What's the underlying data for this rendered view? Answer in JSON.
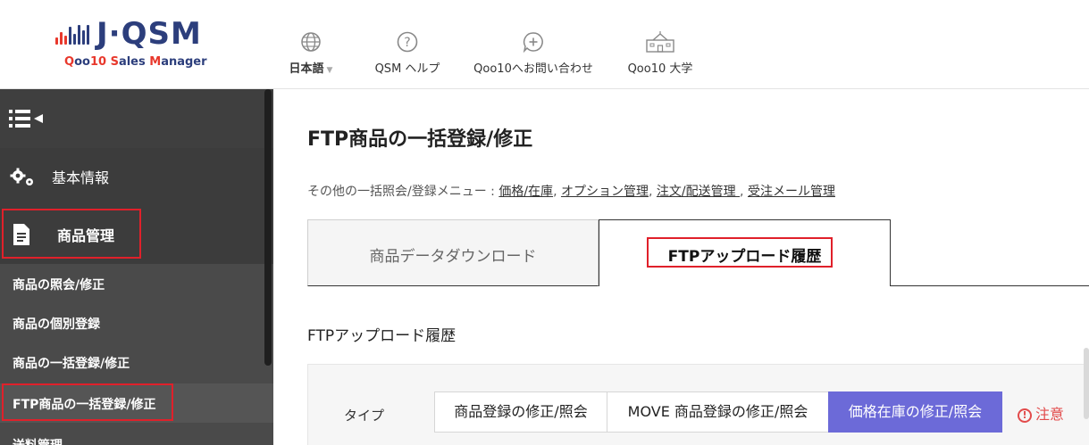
{
  "logo": {
    "brand": "J·QSM",
    "sub_q": "Q",
    "sub_oo": "oo",
    "sub_10": "10",
    "sub_s": "S",
    "sub_ales": "ales ",
    "sub_m": "M",
    "sub_anager": "anager",
    "bar_colors": [
      "#e8382c",
      "#2c3e7c"
    ]
  },
  "topnav": {
    "items": [
      {
        "label": "日本語",
        "icon": "globe-icon"
      },
      {
        "label": "QSM ヘルプ",
        "icon": "help-circle-icon"
      },
      {
        "label": "Qoo10へお問い合わせ",
        "icon": "chat-plus-icon"
      },
      {
        "label": "Qoo10 大学",
        "icon": "school-icon"
      }
    ]
  },
  "sidebar": {
    "basic": "基本情報",
    "goods": "商品管理",
    "subitems": [
      {
        "label": "商品の照会/修正"
      },
      {
        "label": "商品の個別登録"
      },
      {
        "label": "商品の一括登録/修正"
      },
      {
        "label": "FTP商品の一括登録/修正"
      },
      {
        "label": "送料管理"
      }
    ]
  },
  "main": {
    "title": "FTP商品の一括登録/修正",
    "other_menu_prefix": "その他の一括照会/登録メニュー : ",
    "links": [
      {
        "label": "価格/在庫"
      },
      {
        "label": "オプション管理"
      },
      {
        "label": "注文/配送管理 "
      },
      {
        "label": "受注メール管理"
      }
    ],
    "sep": ", ",
    "tabs": [
      {
        "label": "商品データダウンロード"
      },
      {
        "label": "FTPアップロード履歴"
      }
    ],
    "section_title": "FTPアップロード履歴",
    "filter": {
      "type_label": "タイプ",
      "options": [
        {
          "label": "商品登録の修正/照会"
        },
        {
          "label": "MOVE 商品登録の修正/照会"
        },
        {
          "label": "価格在庫の修正/照会"
        }
      ],
      "caution": "注意",
      "caution_icon": "!"
    }
  },
  "colors": {
    "highlight": "#e0202a",
    "active_segment": "#6c6ad8",
    "sidebar_bg": "#4a4a4a"
  }
}
